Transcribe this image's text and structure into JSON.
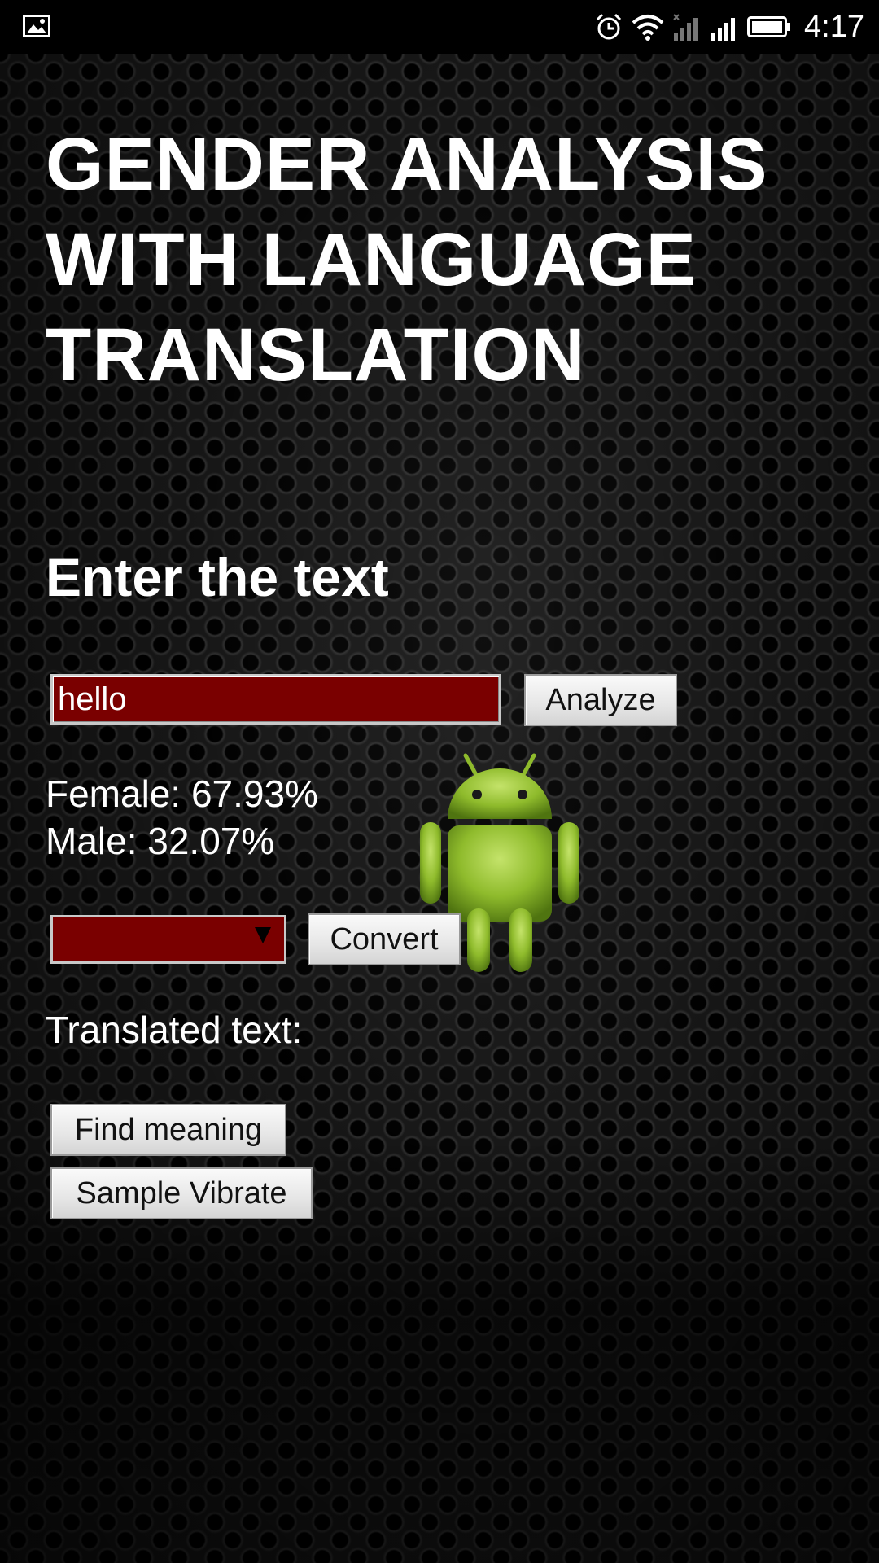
{
  "status_bar": {
    "time": "4:17",
    "icons": [
      "gallery-icon",
      "alarm-icon",
      "wifi-icon",
      "signal-weak-icon",
      "signal-icon",
      "battery-icon"
    ]
  },
  "app": {
    "title_lines": [
      "GENDER ANALYSIS",
      "WITH LANGUAGE",
      "TRANSLATION"
    ],
    "subtitle": "Enter the text",
    "input": {
      "value": "hello",
      "placeholder": ""
    },
    "analyze_label": "Analyze",
    "results": {
      "female": "Female: 67.93%",
      "male": "Male: 32.07%"
    },
    "language_select": {
      "selected": ""
    },
    "convert_label": "Convert",
    "translated_label": "Translated text:",
    "find_meaning_label": "Find meaning",
    "sample_vibrate_label": "Sample Vibrate",
    "mascot": "android-robot-icon"
  },
  "colors": {
    "input_background": "#7a0000",
    "text": "#ffffff",
    "android_green": "#a4c639"
  }
}
